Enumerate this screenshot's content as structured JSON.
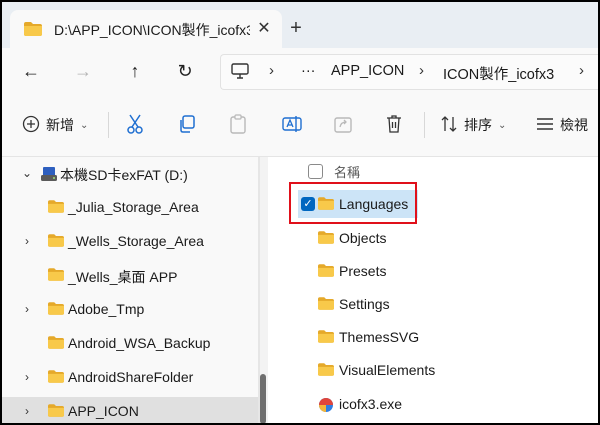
{
  "tab": {
    "title": "D:\\APP_ICON\\ICON製作_icofx3",
    "close": "✕",
    "new_tab": "+"
  },
  "address": {
    "ellipsis": "···",
    "sep": "›",
    "crumbs": [
      "APP_ICON",
      "ICON製作_icofx3"
    ]
  },
  "toolbar": {
    "new_label": "新增",
    "sort_label": "排序",
    "view_label": "檢視"
  },
  "nav": {
    "items": [
      {
        "label": "本機SD卡exFAT (D:)",
        "chevron": "⌄"
      },
      {
        "label": "_Julia_Storage_Area",
        "chevron": ""
      },
      {
        "label": "_Wells_Storage_Area",
        "chevron": "›"
      },
      {
        "label": "_Wells_桌面 APP",
        "chevron": ""
      },
      {
        "label": "Adobe_Tmp",
        "chevron": "›"
      },
      {
        "label": "Android_WSA_Backup",
        "chevron": ""
      },
      {
        "label": "AndroidShareFolder",
        "chevron": "›"
      },
      {
        "label": "APP_ICON",
        "chevron": "›"
      }
    ]
  },
  "files": {
    "column_name": "名稱",
    "sort_indicator": "^",
    "items": [
      {
        "name": "Languages",
        "type": "folder",
        "selected": true
      },
      {
        "name": "Objects",
        "type": "folder"
      },
      {
        "name": "Presets",
        "type": "folder"
      },
      {
        "name": "Settings",
        "type": "folder"
      },
      {
        "name": "ThemesSVG",
        "type": "folder"
      },
      {
        "name": "VisualElements",
        "type": "folder"
      },
      {
        "name": "icofx3.exe",
        "type": "exe"
      }
    ]
  },
  "colors": {
    "folder": "#f8c94a",
    "folder_dark": "#e5a92a",
    "selection": "#cce4f7",
    "accent": "#0067c0",
    "highlight_box": "#e0101a"
  }
}
